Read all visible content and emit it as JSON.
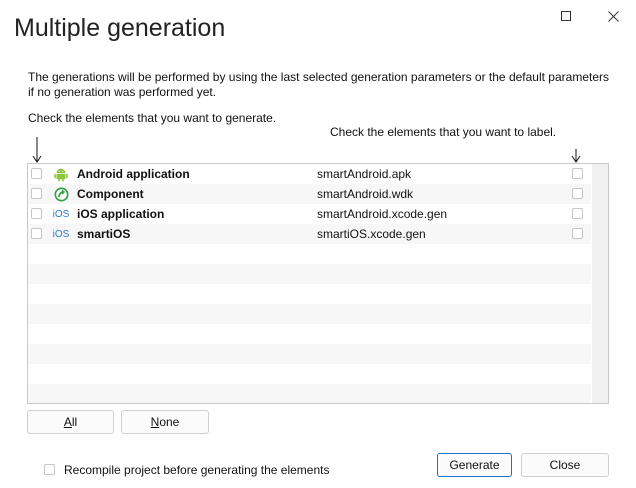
{
  "window": {
    "title": "Multiple generation",
    "maximize_icon": "maximize-icon",
    "close_icon": "close-icon"
  },
  "intro_text": "The generations will be performed by using the last selected generation parameters or the default parameters if no generation was performed yet.",
  "hint_generate": "Check the elements that you want to generate.",
  "hint_label": "Check the elements that you want to label.",
  "items": [
    {
      "name": "Android application",
      "file": "smartAndroid.apk",
      "icon": "android-icon",
      "generate": false,
      "label": false
    },
    {
      "name": "Component",
      "file": "smartAndroid.wdk",
      "icon": "component-icon",
      "generate": false,
      "label": false
    },
    {
      "name": "iOS application",
      "file": "smartAndroid.xcode.gen",
      "icon": "ios-icon",
      "generate": false,
      "label": false
    },
    {
      "name": "smartiOS",
      "file": "smartiOS.xcode.gen",
      "icon": "ios-icon",
      "generate": false,
      "label": false
    }
  ],
  "ios_icon_text": "iOS",
  "buttons": {
    "all_prefix": "",
    "all_underlined": "A",
    "all_rest": "ll",
    "none_underlined": "N",
    "none_rest": "one",
    "generate": "Generate",
    "close": "Close"
  },
  "recompile": {
    "label": "Recompile project before generating the elements",
    "checked": false
  },
  "colors": {
    "android_green": "#8cc63f",
    "component_green": "#3aa04a",
    "ios_blue": "#2b79d6",
    "default_button_border": "#1f6fcc"
  }
}
